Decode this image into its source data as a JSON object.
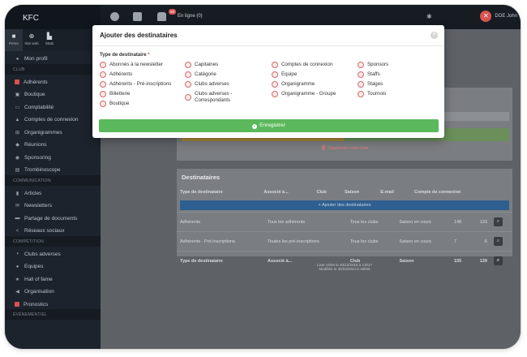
{
  "app": {
    "brand": "KFC"
  },
  "topbar": {
    "notif_count": "68",
    "online_text": "En ligne (0)",
    "user_name": "DOE John"
  },
  "sidebar": {
    "tabs": [
      {
        "label": "Perso",
        "icon": "person-icon"
      },
      {
        "label": "Site web",
        "icon": "globe-icon"
      },
      {
        "label": "Stats",
        "icon": "chart-icon"
      }
    ],
    "profile_label": "Mon profil",
    "sections": [
      {
        "title": "CLUB",
        "items": [
          "Adhérents",
          "Boutique",
          "Comptabilité",
          "Comptes de connexion",
          "Organigrammes",
          "Réunions",
          "Sponsoring",
          "Trombinoscope"
        ]
      },
      {
        "title": "COMMUNICATION",
        "items": [
          "Articles",
          "Newsletters",
          "Partage de documents",
          "Réseaux sociaux"
        ]
      },
      {
        "title": "COMPÉTITION",
        "items": [
          "Clubs adverses",
          "Equipes",
          "Hall of fame",
          "Organisation",
          "Pronostics"
        ]
      },
      {
        "title": "ÉVÉNEMENTIEL",
        "items": []
      }
    ]
  },
  "background": {
    "delete_list": "Supprimer cette liste",
    "destinataires_title": "Destinataires",
    "columns": [
      "Type de destinataire",
      "Associé à...",
      "Club",
      "Saison",
      "E-mail",
      "Compte de connexion"
    ],
    "add_label": "Ajouter des destinataires",
    "rows": [
      {
        "type": "Adhérents",
        "assoc": "Tous les adhérents",
        "club": "Tous les clubs",
        "saison": "Saison en cours",
        "email": "148",
        "compte": "133"
      },
      {
        "type": "Adhérents - Pré-inscriptions",
        "assoc": "Toutes les pré-inscriptions",
        "club": "Tous les clubs",
        "saison": "Saison en cours",
        "email": "7",
        "compte": "6"
      }
    ],
    "total_row": {
      "type": "Type de destinataire",
      "assoc": "Associé à...",
      "club": "Club",
      "saison": "Saison",
      "email": "155",
      "compte": "139"
    },
    "created": "Liste créée le 20/12/2016 à 13h17",
    "modified": "Modifiée le 30/03/2024 à 19h56"
  },
  "modal": {
    "title": "Ajouter des destinataires",
    "field_label": "Type de destinataire",
    "required_mark": "*",
    "options": [
      [
        "Abonnés à la newsletter",
        "Adhérents",
        "Adhérents - Pré-inscriptions",
        "Billetterie",
        "Boutique"
      ],
      [
        "Capitaines",
        "Catégorie",
        "Clubs adverses",
        "Clubs adverses - Correspondants"
      ],
      [
        "Comptes de connexion",
        "Equipe",
        "Organigramme",
        "Organigramme - Groupe"
      ],
      [
        "Sponsors",
        "Staffs",
        "Stages",
        "Tournois"
      ]
    ],
    "save_label": "Enregistrer"
  }
}
